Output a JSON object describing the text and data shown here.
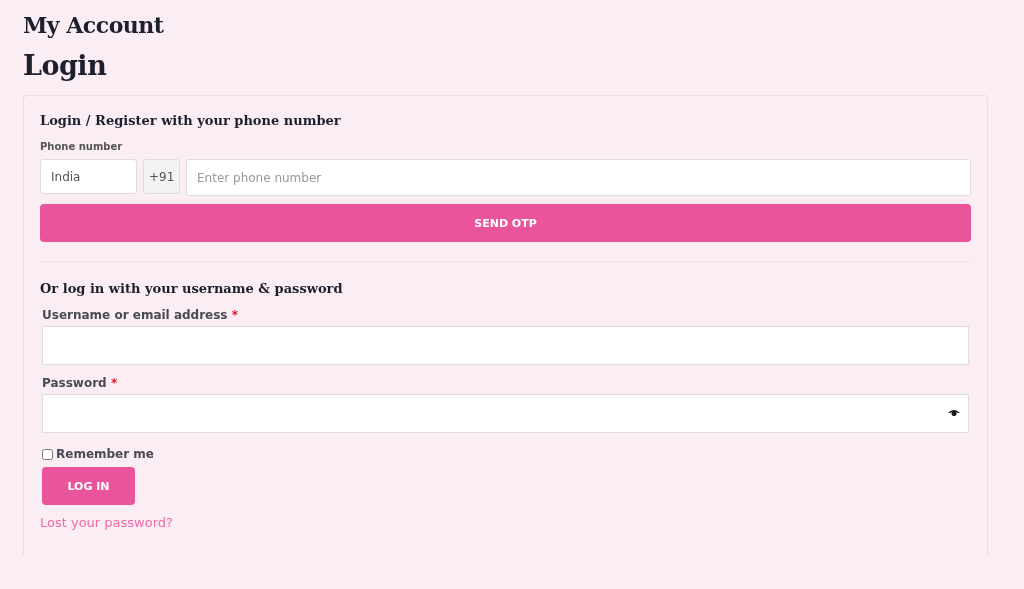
{
  "page_title": "My Account",
  "heading": "Login",
  "phone_section": {
    "title": "Login / Register with your phone number",
    "label": "Phone number",
    "country": "India",
    "dial_code": "+91",
    "placeholder": "Enter phone number",
    "button": "SEND OTP"
  },
  "password_section": {
    "title": "Or log in with your username & password",
    "fields": [
      {
        "label": "Username or email address",
        "required_mark": "*",
        "kind": "text"
      },
      {
        "label": "Password",
        "required_mark": "*",
        "kind": "password"
      }
    ],
    "remember": {
      "label": "Remember me",
      "checked": false
    },
    "button": "LOG IN",
    "lost_link": "Lost your password?"
  }
}
